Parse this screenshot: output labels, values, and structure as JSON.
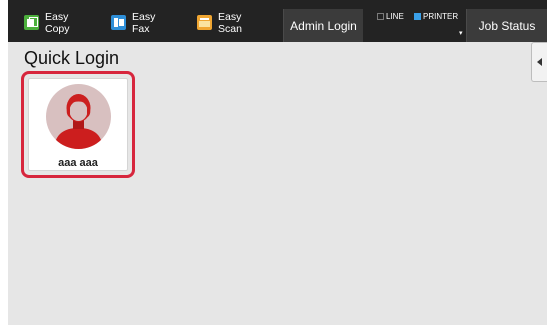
{
  "toolbar": {
    "apps": [
      {
        "line1": "Easy",
        "line2": "Copy",
        "icon": "easy-copy-icon",
        "color": "#4caf3c"
      },
      {
        "line1": "Easy",
        "line2": "Fax",
        "icon": "easy-fax-icon",
        "color": "#2e8fd8"
      },
      {
        "line1": "Easy",
        "line2": "Scan",
        "icon": "easy-scan-icon",
        "color": "#f0a632"
      }
    ],
    "admin_login": "Admin Login",
    "job_status": "Job Status",
    "line_label": "LINE",
    "printer_label": "PRINTER",
    "printer_color": "#3aa0e8"
  },
  "page": {
    "title": "Quick Login"
  },
  "users": [
    {
      "name": "aaa aaa",
      "selected": true,
      "highlight_color": "#d7263d",
      "avatar_color": "#cc1e1e"
    }
  ]
}
